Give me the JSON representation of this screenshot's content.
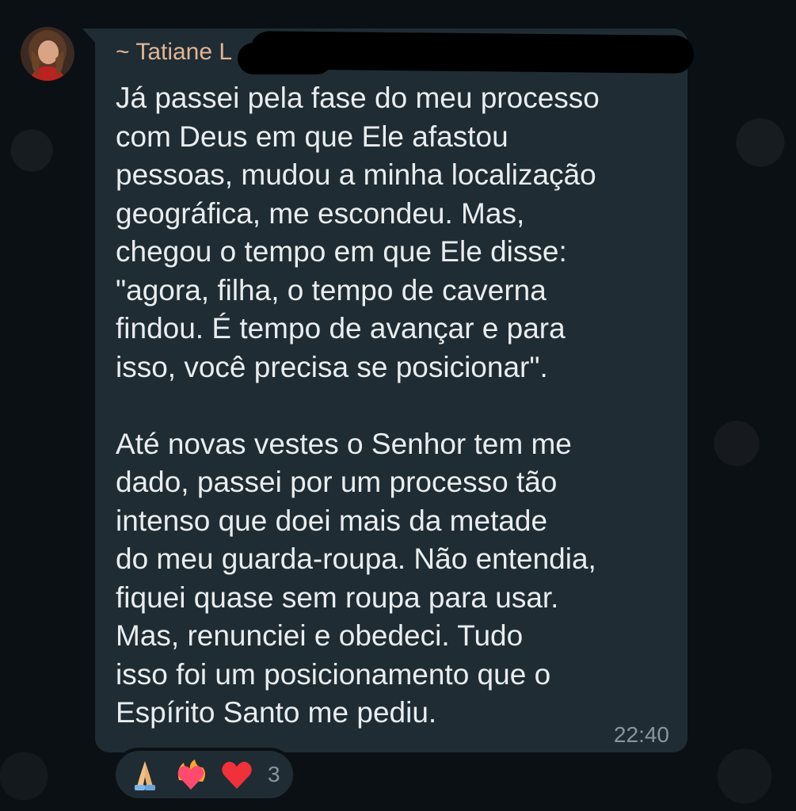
{
  "message": {
    "sender": "~ Tatiane L",
    "paragraph1": [
      "Já passei pela fase do meu processo",
      "com Deus em que Ele afastou",
      "pessoas, mudou a minha localização",
      "geográfica, me escondeu. Mas,",
      "chegou o tempo em que Ele disse:",
      "\"agora, filha, o tempo de caverna",
      "findou. É tempo de avançar e para",
      "isso, você precisa se posicionar\"."
    ],
    "paragraph2": [
      "Até novas vestes o Senhor tem me",
      "dado, passei por um processo tão",
      "intenso que doei mais da metade",
      "do meu guarda-roupa. Não entendia,",
      "fiquei quase sem roupa para usar.",
      "Mas, renunciei e obedeci. Tudo",
      "isso foi um posicionamento que o",
      "Espírito Santo me pediu."
    ],
    "time": "22:40"
  },
  "reactions": {
    "emojis": [
      "praying-hands-icon",
      "heart-on-fire-icon",
      "red-heart-icon"
    ],
    "count": "3"
  },
  "colors": {
    "background": "#0b1014",
    "bubble": "#1f2c33",
    "sender_name": "#e0b594",
    "text": "#e9edef",
    "meta": "#8696a0"
  }
}
